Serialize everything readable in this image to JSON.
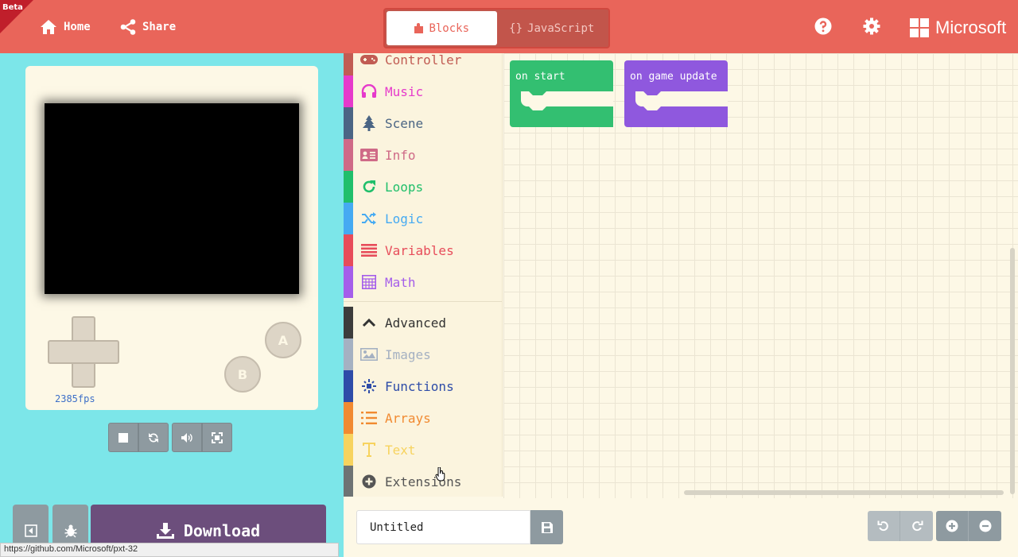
{
  "header": {
    "beta": "Beta",
    "home": "Home",
    "share": "Share",
    "blocks_tab": "Blocks",
    "js_tab_brace": "{}",
    "js_tab": "JavaScript",
    "brand": "Microsoft",
    "accent": "#e9655a"
  },
  "simulator": {
    "fps": "2385fps",
    "btn_a": "A",
    "btn_b": "B",
    "download": "Download"
  },
  "toolbox": {
    "categories": [
      {
        "label": "Controller",
        "color": "#c15c53",
        "icon": "gamepad-icon"
      },
      {
        "label": "Music",
        "color": "#e63acb",
        "icon": "headphones-icon"
      },
      {
        "label": "Scene",
        "color": "#4b6584",
        "icon": "tree-icon"
      },
      {
        "label": "Info",
        "color": "#cf6a87",
        "icon": "id-card-icon"
      },
      {
        "label": "Loops",
        "color": "#20bf6b",
        "icon": "refresh-icon"
      },
      {
        "label": "Logic",
        "color": "#45aaf2",
        "icon": "shuffle-icon"
      },
      {
        "label": "Variables",
        "color": "#e74c5a",
        "icon": "list-icon"
      },
      {
        "label": "Math",
        "color": "#a55eea",
        "icon": "calculator-icon"
      },
      {
        "label": "Advanced",
        "color": "#3c3c3c",
        "icon": "chevron-up-icon"
      },
      {
        "label": "Images",
        "color": "#a5b1c2",
        "icon": "image-icon"
      },
      {
        "label": "Functions",
        "color": "#2e4ca8",
        "icon": "functions-icon"
      },
      {
        "label": "Arrays",
        "color": "#f18a31",
        "icon": "list-numbered-icon"
      },
      {
        "label": "Text",
        "color": "#f7d35e",
        "icon": "text-icon"
      },
      {
        "label": "Extensions",
        "color": "#6e7374",
        "icon": "plus-circle-icon"
      }
    ]
  },
  "workspace": {
    "on_start": "on start",
    "on_game_update": "on game update",
    "on_start_color": "#33bf71",
    "on_game_update_color": "#8f58de"
  },
  "footer": {
    "project_name": "Untitled",
    "status_url": "https://github.com/Microsoft/pxt-32"
  }
}
